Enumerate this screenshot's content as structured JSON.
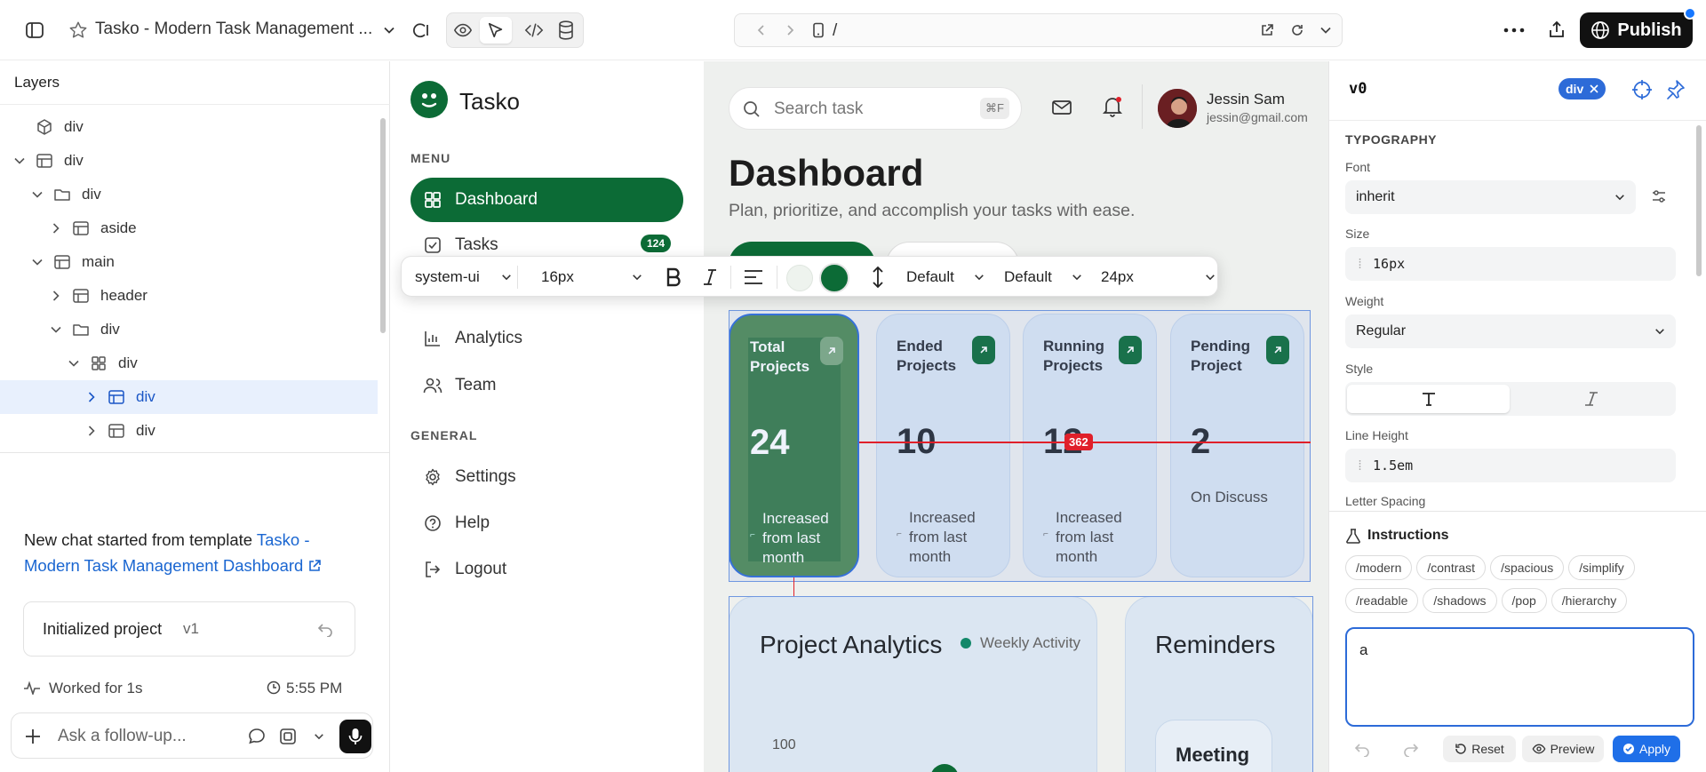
{
  "topbar": {
    "project_title": "Tasko - Modern Task Management ...",
    "url_path": "/",
    "publish_label": "Publish"
  },
  "layers": {
    "title": "Layers",
    "rows": [
      "div",
      "div",
      "div",
      "aside",
      "main",
      "header",
      "div",
      "div",
      "div",
      "div"
    ]
  },
  "chat": {
    "message_prefix": "New chat started from template",
    "message_link": "Tasko - Modern Task Management Dashboard",
    "card_label": "Initialized project",
    "card_version": "v1",
    "worked_for": "Worked for 1s",
    "time": "5:55 PM",
    "followup_placeholder": "Ask a follow-up..."
  },
  "app": {
    "brand": "Tasko",
    "menu_label": "MENU",
    "general_label": "GENERAL",
    "nav": [
      {
        "label": "Dashboard"
      },
      {
        "label": "Tasks",
        "badge": "124"
      },
      {
        "label": "Analytics"
      },
      {
        "label": "Team"
      }
    ],
    "general": [
      {
        "label": "Settings"
      },
      {
        "label": "Help"
      },
      {
        "label": "Logout"
      }
    ],
    "search_placeholder": "Search task",
    "search_shortcut": "⌘F",
    "user_name": "Jessin Sam",
    "user_email": "jessin@gmail.com",
    "page_title": "Dashboard",
    "page_subtitle": "Plan, prioritize, and accomplish your tasks with ease.",
    "cards": [
      {
        "title": "Total Projects",
        "value": "24",
        "desc": "Increased from last month"
      },
      {
        "title": "Ended Projects",
        "value": "10",
        "desc": "Increased from last month"
      },
      {
        "title": "Running Projects",
        "value": "12",
        "desc": "Increased from last month"
      },
      {
        "title": "Pending Project",
        "value": "2",
        "desc": "On Discuss"
      }
    ],
    "measure_badge": "362",
    "analytics_title": "Project Analytics",
    "analytics_legend": "Weekly Activity",
    "analytics_tick": "100",
    "reminders_title": "Reminders",
    "reminder_item": "Meeting"
  },
  "format_toolbar": {
    "font": "system-ui",
    "size": "16px",
    "letter_spacing": "Default",
    "word_spacing": "Default",
    "line_height": "24px"
  },
  "inspector": {
    "element_tag": "div",
    "section_title": "TYPOGRAPHY",
    "font_label": "Font",
    "font_value": "inherit",
    "size_label": "Size",
    "size_value": "16px",
    "weight_label": "Weight",
    "weight_value": "Regular",
    "style_label": "Style",
    "line_height_label": "Line Height",
    "line_height_value": "1.5em",
    "letter_spacing_label": "Letter Spacing",
    "instructions_title": "Instructions",
    "chips": [
      "/modern",
      "/contrast",
      "/spacious",
      "/simplify",
      "/readable",
      "/shadows",
      "/pop",
      "/hierarchy"
    ],
    "textarea_value": "a",
    "reset_label": "Reset",
    "preview_label": "Preview",
    "apply_label": "Apply"
  },
  "colors": {
    "brand_green": "#0c6b36",
    "selection_blue": "#2d6bd8",
    "measure_red": "#e0202a"
  }
}
